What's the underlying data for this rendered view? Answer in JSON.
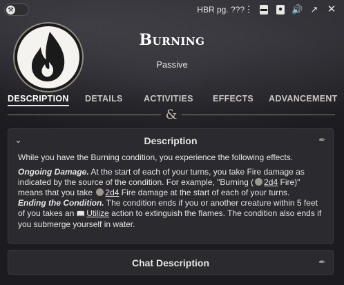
{
  "topbar": {
    "source": "HBR pg. ???",
    "icons": [
      "wrench-icon",
      "kebab-menu-icon",
      "document-icon",
      "token-icon",
      "speaker-icon",
      "external-link-icon",
      "close-icon"
    ]
  },
  "header": {
    "title": "Burning",
    "subtitle": "Passive",
    "portrait_icon": "flame-icon"
  },
  "tabs": [
    {
      "label": "DESCRIPTION",
      "active": true
    },
    {
      "label": "DETAILS",
      "active": false
    },
    {
      "label": "ACTIVITIES",
      "active": false
    },
    {
      "label": "EFFECTS",
      "active": false
    },
    {
      "label": "ADVANCEMENT",
      "active": false
    }
  ],
  "divider_glyph": "&",
  "description_card": {
    "title": "Description",
    "intro": "While you have the Burning condition, you experience the following effects.",
    "ongoing": {
      "label": "Ongoing Damage.",
      "text1": "At the start of each of your turns, you take Fire damage as indicated by the source of the condition. For example, \"Burning (",
      "roll1": "2d4",
      "text2": " Fire)\" means that you take ",
      "roll2": "2d4",
      "text3": " Fire damage at the start of each of your turns."
    },
    "ending": {
      "label": "Ending the Condition.",
      "text1": "The condition ends if you or another creature within 5 feet of you takes an ",
      "action": "Utilize",
      "text2": " action to extinguish the flames. The condition also ends if you submerge yourself in water."
    }
  },
  "chat_card": {
    "title": "Chat Description"
  },
  "colors": {
    "background": "#1c1c20",
    "card": "#2a2a2f",
    "text": "#e8e6e3",
    "accent": "#8e8a80"
  }
}
